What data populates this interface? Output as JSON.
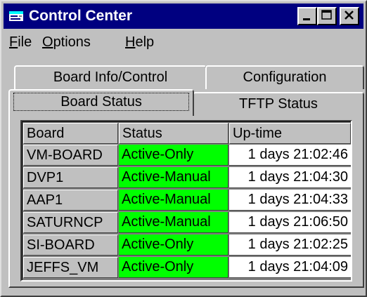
{
  "window": {
    "title": "Control Center"
  },
  "menu": [
    {
      "label": "File"
    },
    {
      "label": "Options"
    },
    {
      "label": "Help"
    }
  ],
  "tabs": {
    "row_back": [
      "Board Info/Control",
      "Configuration"
    ],
    "row_front": [
      "Board Status",
      "TFTP Status"
    ],
    "selected": "Board Status"
  },
  "table": {
    "headers": [
      "Board",
      "Status",
      "Up-time"
    ],
    "rows": [
      {
        "board": "VM-BOARD",
        "status": "Active-Only",
        "uptime": "1 days 21:02:46"
      },
      {
        "board": "DVP1",
        "status": "Active-Manual",
        "uptime": "1 days 21:04:30"
      },
      {
        "board": "AAP1",
        "status": "Active-Manual",
        "uptime": "1 days 21:04:33"
      },
      {
        "board": "SATURNCP",
        "status": "Active-Manual",
        "uptime": "1 days 21:06:50"
      },
      {
        "board": "SI-BOARD",
        "status": "Active-Only",
        "uptime": "1 days 21:02:25"
      },
      {
        "board": "JEFFS_VM",
        "status": "Active-Only",
        "uptime": "1 days 21:04:09"
      }
    ]
  },
  "colors": {
    "titlebar": "#000080",
    "face": "#c0c0c0",
    "status_active": "#00ff00"
  },
  "icons": [
    "app-icon",
    "minimize-icon",
    "maximize-icon",
    "close-icon"
  ]
}
